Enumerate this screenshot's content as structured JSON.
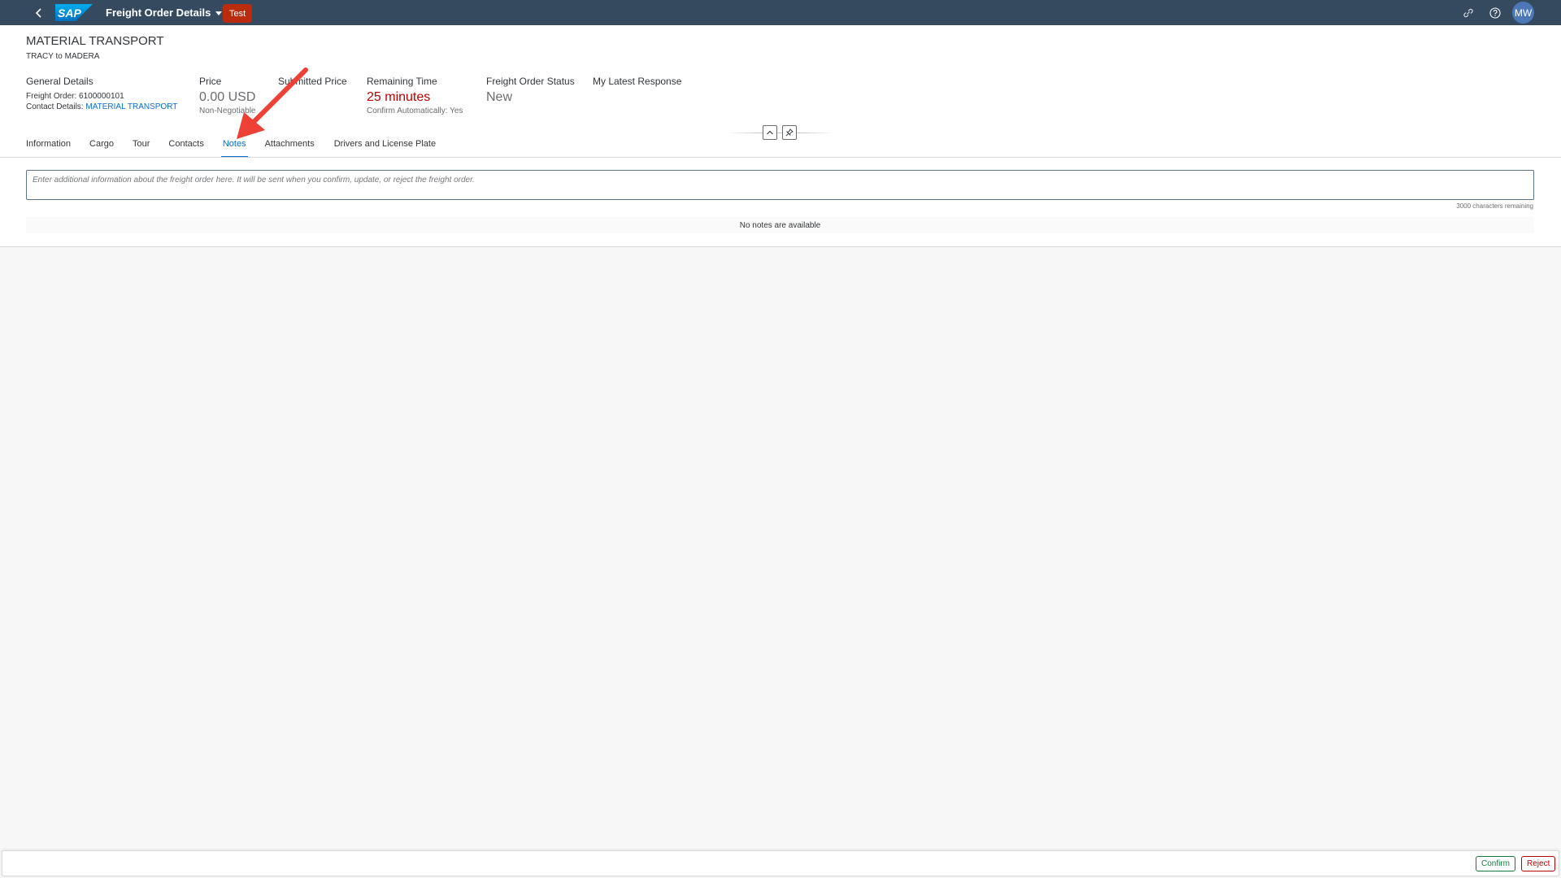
{
  "shellbar": {
    "app_title": "Freight Order Details",
    "env_badge": "Test",
    "avatar_initials": "MW",
    "logo_text": "SAP"
  },
  "header": {
    "title": "MATERIAL TRANSPORT",
    "subtitle": "TRACY to MADERA",
    "general_details": {
      "label": "General Details",
      "freight_order": "Freight Order: 6100000101",
      "contact_label": "Contact Details: ",
      "contact_link": "MATERIAL TRANSPORT"
    },
    "price": {
      "label": "Price",
      "value": "0.00 USD",
      "note": "Non-Negotiable"
    },
    "submitted_price": {
      "label": "Submitted Price"
    },
    "remaining_time": {
      "label": "Remaining Time",
      "value": "25 minutes",
      "note": "Confirm Automatically: Yes"
    },
    "status": {
      "label": "Freight Order Status",
      "value": "New"
    },
    "latest_response": {
      "label": "My Latest Response"
    }
  },
  "tabs": [
    {
      "label": "Information"
    },
    {
      "label": "Cargo"
    },
    {
      "label": "Tour"
    },
    {
      "label": "Contacts"
    },
    {
      "label": "Notes"
    },
    {
      "label": "Attachments"
    },
    {
      "label": "Drivers and License Plate"
    }
  ],
  "active_tab": "Notes",
  "notes": {
    "placeholder": "Enter additional information about the freight order here. It will be sent when you confirm, update, or reject the freight order.",
    "chars_remaining": "3000 characters remaining",
    "empty_text": "No notes are available"
  },
  "footer": {
    "confirm_label": "Confirm",
    "reject_label": "Reject"
  },
  "colors": {
    "shell": "#354a5f",
    "accent": "#0a6ed1",
    "badge": "#bb2c0e",
    "negative": "#bb0000",
    "positive": "#107e3e",
    "annotation_arrow": "#ee4035"
  }
}
